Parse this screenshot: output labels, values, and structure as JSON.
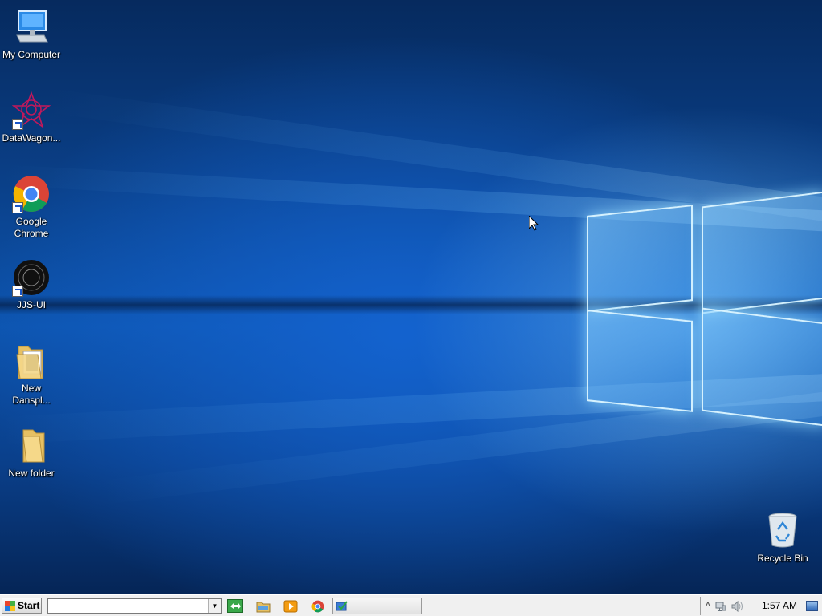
{
  "desktop": {
    "icons": [
      {
        "label": "My Computer",
        "icon": "computer-icon"
      },
      {
        "label": "DataWagon...",
        "icon": "datawagon-icon",
        "shortcut": true
      },
      {
        "label": "Google Chrome",
        "icon": "chrome-icon",
        "shortcut": true
      },
      {
        "label": "JJS-UI",
        "icon": "jjs-ui-icon",
        "shortcut": true
      },
      {
        "label": "New Danspl...",
        "icon": "folder-icon"
      },
      {
        "label": "New folder",
        "icon": "folder-icon"
      },
      {
        "label": "Recycle Bin",
        "icon": "recycle-bin-icon"
      }
    ]
  },
  "taskbar": {
    "start_label": "Start",
    "address_value": "",
    "quick_launch": [
      {
        "icon": "show-desktop-switch-icon"
      },
      {
        "icon": "explorer-folder-icon"
      },
      {
        "icon": "media-player-icon"
      },
      {
        "icon": "chrome-icon"
      }
    ],
    "task_window_label": "",
    "tray": {
      "icons": [
        "chevron-up-icon",
        "network-icon",
        "volume-icon"
      ],
      "clock": "1:57 AM"
    }
  },
  "colors": {
    "wallpaper_base": "#0a3f87",
    "wallpaper_glow": "#8cd2ff",
    "taskbar_bg": "#f0f0f0"
  }
}
